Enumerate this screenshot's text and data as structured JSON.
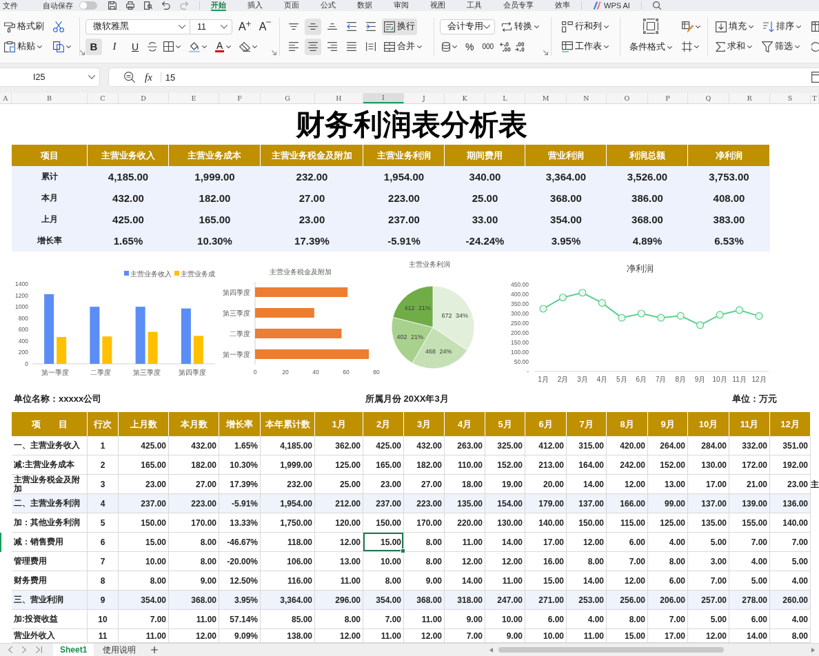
{
  "top_bar": {
    "file": "文件",
    "autosave": {
      "label": "自动保存",
      "on": false
    },
    "tabs": [
      {
        "label": "开始",
        "selected": true
      },
      {
        "label": "插入",
        "selected": false
      },
      {
        "label": "页面",
        "selected": false
      },
      {
        "label": "公式",
        "selected": false
      },
      {
        "label": "数据",
        "selected": false
      },
      {
        "label": "审阅",
        "selected": false
      },
      {
        "label": "视图",
        "selected": false
      },
      {
        "label": "工具",
        "selected": false
      },
      {
        "label": "会员专享",
        "selected": false
      },
      {
        "label": "效率",
        "selected": false
      }
    ],
    "ai": "WPS AI"
  },
  "ribbon": {
    "format_painter": "格式刷",
    "paste": "粘贴",
    "font_family": "微软雅黑",
    "font_size": "11",
    "size_buttons": [
      {
        "kind": "grow",
        "label": "A"
      },
      {
        "kind": "shrink",
        "label": "A"
      }
    ],
    "styles": [
      {
        "kind": "bold",
        "label": "B",
        "selected": true
      },
      {
        "kind": "italic",
        "label": "I",
        "selected": false
      },
      {
        "kind": "underline",
        "label": "U",
        "selected": false
      }
    ],
    "font_color": "A",
    "vertical_align": [
      {
        "kind": "top",
        "selected": false
      },
      {
        "kind": "middle",
        "selected": true
      },
      {
        "kind": "bottom",
        "selected": false
      }
    ],
    "wrap": {
      "label": "换行",
      "on": true
    },
    "horizontal_align": [
      {
        "kind": "left",
        "selected": false
      },
      {
        "kind": "center",
        "selected": true
      },
      {
        "kind": "right",
        "selected": false
      },
      {
        "kind": "justify",
        "selected": false
      },
      {
        "kind": "distributed",
        "selected": false
      }
    ],
    "merge": "合并",
    "number_format": "会计专用",
    "convert": "转换",
    "number_buttons": [
      {
        "kind": "percent",
        "label": "%"
      },
      {
        "kind": "thousands",
        "label": "000"
      }
    ],
    "rows_and_columns": "行和列",
    "worksheet": "工作表",
    "conditional_format": "条件格式",
    "fill": "填充",
    "sort": "排序",
    "sum": "求和",
    "filter": "筛选"
  },
  "formula_bar": {
    "cell_ref": "I25",
    "function_label": "fx",
    "value": "15"
  },
  "columns": [
    {
      "label": "A",
      "selected": false
    },
    {
      "label": "B",
      "selected": false
    },
    {
      "label": "C",
      "selected": false
    },
    {
      "label": "D",
      "selected": false
    },
    {
      "label": "E",
      "selected": false
    },
    {
      "label": "F",
      "selected": false
    },
    {
      "label": "G",
      "selected": false
    },
    {
      "label": "H",
      "selected": false
    },
    {
      "label": "I",
      "selected": true
    },
    {
      "label": "J",
      "selected": false
    },
    {
      "label": "K",
      "selected": false
    },
    {
      "label": "L",
      "selected": false
    },
    {
      "label": "M",
      "selected": false
    },
    {
      "label": "N",
      "selected": false
    },
    {
      "label": "O",
      "selected": false
    },
    {
      "label": "P",
      "selected": false
    },
    {
      "label": "Q",
      "selected": false
    },
    {
      "label": "R",
      "selected": false
    },
    {
      "label": "S",
      "selected": false
    },
    {
      "label": "T",
      "selected": false
    }
  ],
  "title": "财务利润表分析表",
  "summary": {
    "columns": [
      "项目",
      "主营业务收入",
      "主营业务成本",
      "主营业务税金及附加",
      "主营业务利润",
      "期间费用",
      "营业利润",
      "利润总额",
      "净利润"
    ],
    "rows": [
      [
        "累计",
        "4,185.00",
        "1,999.00",
        "232.00",
        "1,954.00",
        "340.00",
        "3,364.00",
        "3,526.00",
        "3,753.00"
      ],
      [
        "本月",
        "432.00",
        "182.00",
        "27.00",
        "223.00",
        "25.00",
        "368.00",
        "386.00",
        "408.00"
      ],
      [
        "上月",
        "425.00",
        "165.00",
        "23.00",
        "237.00",
        "33.00",
        "354.00",
        "368.00",
        "383.00"
      ],
      [
        "增长率",
        "1.65%",
        "10.30%",
        "17.39%",
        "-5.91%",
        "-24.24%",
        "3.95%",
        "4.89%",
        "6.53%"
      ]
    ]
  },
  "charts": [
    {
      "chart_data": {
        "type": "bar",
        "legend": "top",
        "categories": [
          "第一季度",
          "二季度",
          "第三季度",
          "第四季度"
        ],
        "series": [
          {
            "name": "主营业务收入",
            "color": "#5A8DF5",
            "values": [
              1220,
              1000,
              1000,
              970
            ]
          },
          {
            "name": "主营业务成",
            "color": "#FFC000",
            "values": [
              470,
              480,
              560,
              490
            ]
          }
        ],
        "ylim": [
          0,
          1400
        ],
        "yticks": [
          0,
          200,
          400,
          600,
          800,
          1000,
          1200,
          1400
        ]
      }
    },
    {
      "chart_data": {
        "type": "bar",
        "orientation": "horizontal",
        "title": "主营业务税金及附加",
        "categories": [
          "第四季度",
          "第三季度",
          "二季度",
          "第一季度"
        ],
        "series": [
          {
            "color": "#ED7D31",
            "values": [
              61,
              39,
              57,
              75
            ]
          }
        ],
        "xlim": [
          0,
          80
        ],
        "xticks": [
          0,
          20,
          40,
          60,
          80
        ]
      }
    },
    {
      "chart_data": {
        "type": "pie",
        "title": "主营业务利润",
        "values": [
          672,
          468,
          402,
          412
        ],
        "value_labels": [
          "672 34%",
          "468 24%",
          "402 21%",
          "412 21%"
        ]
      }
    },
    {
      "chart_data": {
        "type": "line",
        "title": "净利润",
        "categories": [
          "1月",
          "2月",
          "3月",
          "4月",
          "5月",
          "6月",
          "7月",
          "8月",
          "9月",
          "10月",
          "11月",
          "12月"
        ],
        "series": [
          {
            "color": "#5ACF8C",
            "marker": "circle",
            "values": [
              325,
              383,
              408,
              355,
              278,
              300,
              278,
              288,
              240,
              293,
              318,
              287
            ]
          }
        ],
        "ylim": [
          0,
          450
        ],
        "yticks": [
          {
            "value": 0,
            "label": "-"
          },
          {
            "value": 50,
            "label": "50.00"
          },
          {
            "value": 100,
            "label": "100.00"
          },
          {
            "value": 150,
            "label": "150.00"
          },
          {
            "value": 200,
            "label": "200.00"
          },
          {
            "value": 250,
            "label": "250.00"
          },
          {
            "value": 300,
            "label": "300.00"
          },
          {
            "value": 350,
            "label": "350.00"
          },
          {
            "value": 400,
            "label": "400.00"
          },
          {
            "value": 450,
            "label": "450.00"
          }
        ]
      }
    }
  ],
  "report": {
    "company": "单位名称：xxxxx公司",
    "period": "所属月份 20XX年3月",
    "unit": "单位：万元",
    "columns": [
      "项　　目",
      "行次",
      "上月数",
      "本月数",
      "增长率",
      "本年累计数",
      "1月",
      "2月",
      "3月",
      "4月",
      "5月",
      "6月",
      "7月",
      "8月",
      "9月",
      "10月",
      "11月",
      "12月"
    ],
    "rows": [
      {
        "kind": "item",
        "cells": [
          {
            "text": "一、主营业务收入",
            "selected": false
          },
          {
            "text": "1",
            "selected": false
          },
          {
            "text": "425.00",
            "selected": false
          },
          {
            "text": "432.00",
            "selected": false
          },
          {
            "text": "1.65%",
            "selected": false
          },
          {
            "text": "4,185.00",
            "selected": false
          },
          {
            "text": "362.00",
            "selected": false
          },
          {
            "text": "425.00",
            "selected": false
          },
          {
            "text": "432.00",
            "selected": false
          },
          {
            "text": "263.00",
            "selected": false
          },
          {
            "text": "325.00",
            "selected": false
          },
          {
            "text": "412.00",
            "selected": false
          },
          {
            "text": "315.00",
            "selected": false
          },
          {
            "text": "420.00",
            "selected": false
          },
          {
            "text": "264.00",
            "selected": false
          },
          {
            "text": "284.00",
            "selected": false
          },
          {
            "text": "332.00",
            "selected": false
          },
          {
            "text": "351.00",
            "selected": false
          }
        ]
      },
      {
        "kind": "item",
        "cells": [
          {
            "text": "减:主营业务成本",
            "selected": false
          },
          {
            "text": "2",
            "selected": false
          },
          {
            "text": "165.00",
            "selected": false
          },
          {
            "text": "182.00",
            "selected": false
          },
          {
            "text": "10.30%",
            "selected": false
          },
          {
            "text": "1,999.00",
            "selected": false
          },
          {
            "text": "125.00",
            "selected": false
          },
          {
            "text": "165.00",
            "selected": false
          },
          {
            "text": "182.00",
            "selected": false
          },
          {
            "text": "110.00",
            "selected": false
          },
          {
            "text": "152.00",
            "selected": false
          },
          {
            "text": "213.00",
            "selected": false
          },
          {
            "text": "164.00",
            "selected": false
          },
          {
            "text": "242.00",
            "selected": false
          },
          {
            "text": "152.00",
            "selected": false
          },
          {
            "text": "130.00",
            "selected": false
          },
          {
            "text": "172.00",
            "selected": false
          },
          {
            "text": "192.00",
            "selected": false
          }
        ]
      },
      {
        "kind": "item",
        "overflow": "主",
        "cells": [
          {
            "text": "主营业务税金及附加",
            "selected": false
          },
          {
            "text": "3",
            "selected": false
          },
          {
            "text": "23.00",
            "selected": false
          },
          {
            "text": "27.00",
            "selected": false
          },
          {
            "text": "17.39%",
            "selected": false
          },
          {
            "text": "232.00",
            "selected": false
          },
          {
            "text": "25.00",
            "selected": false
          },
          {
            "text": "23.00",
            "selected": false
          },
          {
            "text": "27.00",
            "selected": false
          },
          {
            "text": "18.00",
            "selected": false
          },
          {
            "text": "19.00",
            "selected": false
          },
          {
            "text": "20.00",
            "selected": false
          },
          {
            "text": "14.00",
            "selected": false
          },
          {
            "text": "12.00",
            "selected": false
          },
          {
            "text": "13.00",
            "selected": false
          },
          {
            "text": "17.00",
            "selected": false
          },
          {
            "text": "21.00",
            "selected": false
          },
          {
            "text": "23.00",
            "selected": false
          }
        ]
      },
      {
        "kind": "subtotal",
        "cells": [
          {
            "text": "二、主营业务利润",
            "selected": false
          },
          {
            "text": "4",
            "selected": false
          },
          {
            "text": "237.00",
            "selected": false
          },
          {
            "text": "223.00",
            "selected": false
          },
          {
            "text": "-5.91%",
            "selected": false
          },
          {
            "text": "1,954.00",
            "selected": false
          },
          {
            "text": "212.00",
            "selected": false
          },
          {
            "text": "237.00",
            "selected": false
          },
          {
            "text": "223.00",
            "selected": false
          },
          {
            "text": "135.00",
            "selected": false
          },
          {
            "text": "154.00",
            "selected": false
          },
          {
            "text": "179.00",
            "selected": false
          },
          {
            "text": "137.00",
            "selected": false
          },
          {
            "text": "166.00",
            "selected": false
          },
          {
            "text": "99.00",
            "selected": false
          },
          {
            "text": "137.00",
            "selected": false
          },
          {
            "text": "139.00",
            "selected": false
          },
          {
            "text": "136.00",
            "selected": false
          }
        ]
      },
      {
        "kind": "item",
        "cells": [
          {
            "text": "加：其他业务利润",
            "selected": false
          },
          {
            "text": "5",
            "selected": false
          },
          {
            "text": "150.00",
            "selected": false
          },
          {
            "text": "170.00",
            "selected": false
          },
          {
            "text": "13.33%",
            "selected": false
          },
          {
            "text": "1,750.00",
            "selected": false
          },
          {
            "text": "120.00",
            "selected": false
          },
          {
            "text": "150.00",
            "selected": false
          },
          {
            "text": "170.00",
            "selected": false
          },
          {
            "text": "220.00",
            "selected": false
          },
          {
            "text": "130.00",
            "selected": false
          },
          {
            "text": "140.00",
            "selected": false
          },
          {
            "text": "150.00",
            "selected": false
          },
          {
            "text": "115.00",
            "selected": false
          },
          {
            "text": "125.00",
            "selected": false
          },
          {
            "text": "135.00",
            "selected": false
          },
          {
            "text": "155.00",
            "selected": false
          },
          {
            "text": "140.00",
            "selected": false
          }
        ]
      },
      {
        "kind": "item",
        "cells": [
          {
            "text": "减：销售费用",
            "selected": false
          },
          {
            "text": "6",
            "selected": false
          },
          {
            "text": "15.00",
            "selected": false
          },
          {
            "text": "8.00",
            "selected": false
          },
          {
            "text": "-46.67%",
            "selected": false
          },
          {
            "text": "118.00",
            "selected": false
          },
          {
            "text": "12.00",
            "selected": false
          },
          {
            "text": "15.00",
            "selected": true
          },
          {
            "text": "8.00",
            "selected": false
          },
          {
            "text": "11.00",
            "selected": false
          },
          {
            "text": "14.00",
            "selected": false
          },
          {
            "text": "17.00",
            "selected": false
          },
          {
            "text": "12.00",
            "selected": false
          },
          {
            "text": "6.00",
            "selected": false
          },
          {
            "text": "4.00",
            "selected": false
          },
          {
            "text": "5.00",
            "selected": false
          },
          {
            "text": "7.00",
            "selected": false
          },
          {
            "text": "7.00",
            "selected": false
          }
        ]
      },
      {
        "kind": "item",
        "cells": [
          {
            "text": "管理费用",
            "selected": false
          },
          {
            "text": "7",
            "selected": false
          },
          {
            "text": "10.00",
            "selected": false
          },
          {
            "text": "8.00",
            "selected": false
          },
          {
            "text": "-20.00%",
            "selected": false
          },
          {
            "text": "106.00",
            "selected": false
          },
          {
            "text": "13.00",
            "selected": false
          },
          {
            "text": "10.00",
            "selected": false
          },
          {
            "text": "8.00",
            "selected": false
          },
          {
            "text": "12.00",
            "selected": false
          },
          {
            "text": "12.00",
            "selected": false
          },
          {
            "text": "16.00",
            "selected": false
          },
          {
            "text": "8.00",
            "selected": false
          },
          {
            "text": "7.00",
            "selected": false
          },
          {
            "text": "8.00",
            "selected": false
          },
          {
            "text": "3.00",
            "selected": false
          },
          {
            "text": "4.00",
            "selected": false
          },
          {
            "text": "5.00",
            "selected": false
          }
        ]
      },
      {
        "kind": "item",
        "cells": [
          {
            "text": "财务费用",
            "selected": false
          },
          {
            "text": "8",
            "selected": false
          },
          {
            "text": "8.00",
            "selected": false
          },
          {
            "text": "9.00",
            "selected": false
          },
          {
            "text": "12.50%",
            "selected": false
          },
          {
            "text": "116.00",
            "selected": false
          },
          {
            "text": "11.00",
            "selected": false
          },
          {
            "text": "8.00",
            "selected": false
          },
          {
            "text": "9.00",
            "selected": false
          },
          {
            "text": "14.00",
            "selected": false
          },
          {
            "text": "11.00",
            "selected": false
          },
          {
            "text": "15.00",
            "selected": false
          },
          {
            "text": "14.00",
            "selected": false
          },
          {
            "text": "12.00",
            "selected": false
          },
          {
            "text": "6.00",
            "selected": false
          },
          {
            "text": "7.00",
            "selected": false
          },
          {
            "text": "5.00",
            "selected": false
          },
          {
            "text": "4.00",
            "selected": false
          }
        ]
      },
      {
        "kind": "subtotal",
        "cells": [
          {
            "text": "三、营业利润",
            "selected": false
          },
          {
            "text": "9",
            "selected": false
          },
          {
            "text": "354.00",
            "selected": false
          },
          {
            "text": "368.00",
            "selected": false
          },
          {
            "text": "3.95%",
            "selected": false
          },
          {
            "text": "3,364.00",
            "selected": false
          },
          {
            "text": "296.00",
            "selected": false
          },
          {
            "text": "354.00",
            "selected": false
          },
          {
            "text": "368.00",
            "selected": false
          },
          {
            "text": "318.00",
            "selected": false
          },
          {
            "text": "247.00",
            "selected": false
          },
          {
            "text": "271.00",
            "selected": false
          },
          {
            "text": "253.00",
            "selected": false
          },
          {
            "text": "256.00",
            "selected": false
          },
          {
            "text": "206.00",
            "selected": false
          },
          {
            "text": "257.00",
            "selected": false
          },
          {
            "text": "278.00",
            "selected": false
          },
          {
            "text": "260.00",
            "selected": false
          }
        ]
      },
      {
        "kind": "item",
        "cells": [
          {
            "text": "加:投资收益",
            "selected": false
          },
          {
            "text": "10",
            "selected": false
          },
          {
            "text": "7.00",
            "selected": false
          },
          {
            "text": "11.00",
            "selected": false
          },
          {
            "text": "57.14%",
            "selected": false
          },
          {
            "text": "85.00",
            "selected": false
          },
          {
            "text": "8.00",
            "selected": false
          },
          {
            "text": "7.00",
            "selected": false
          },
          {
            "text": "11.00",
            "selected": false
          },
          {
            "text": "9.00",
            "selected": false
          },
          {
            "text": "10.00",
            "selected": false
          },
          {
            "text": "6.00",
            "selected": false
          },
          {
            "text": "4.00",
            "selected": false
          },
          {
            "text": "8.00",
            "selected": false
          },
          {
            "text": "7.00",
            "selected": false
          },
          {
            "text": "5.00",
            "selected": false
          },
          {
            "text": "6.00",
            "selected": false
          },
          {
            "text": "4.00",
            "selected": false
          }
        ]
      },
      {
        "kind": "item",
        "cells": [
          {
            "text": "营业外收入",
            "selected": false
          },
          {
            "text": "11",
            "selected": false
          },
          {
            "text": "11.00",
            "selected": false
          },
          {
            "text": "12.00",
            "selected": false
          },
          {
            "text": "9.09%",
            "selected": false
          },
          {
            "text": "138.00",
            "selected": false
          },
          {
            "text": "12.00",
            "selected": false
          },
          {
            "text": "11.00",
            "selected": false
          },
          {
            "text": "12.00",
            "selected": false
          },
          {
            "text": "7.00",
            "selected": false
          },
          {
            "text": "9.00",
            "selected": false
          },
          {
            "text": "10.00",
            "selected": false
          },
          {
            "text": "11.00",
            "selected": false
          },
          {
            "text": "15.00",
            "selected": false
          },
          {
            "text": "17.00",
            "selected": false
          },
          {
            "text": "12.00",
            "selected": false
          },
          {
            "text": "14.00",
            "selected": false
          },
          {
            "text": "8.00",
            "selected": false
          }
        ]
      }
    ]
  },
  "sheet_tabs": [
    {
      "label": "Sheet1",
      "selected": true
    },
    {
      "label": "使用说明",
      "selected": false
    }
  ]
}
